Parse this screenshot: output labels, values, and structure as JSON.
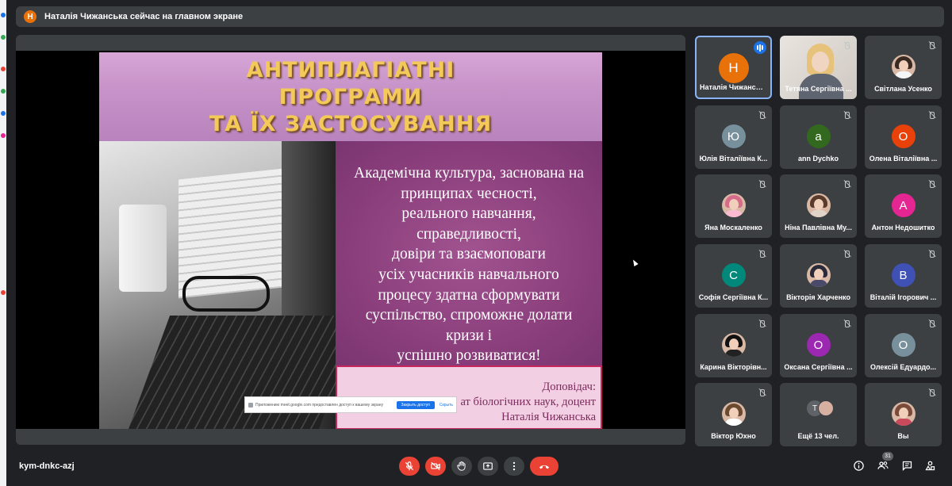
{
  "banner": {
    "avatar_letter": "Н",
    "text": "Наталія Чижанська сейчас на главном экране"
  },
  "slide": {
    "title_lines": [
      "АНТИПЛАГІАТНІ",
      "ПРОГРАМИ",
      "ТА ЇХ ЗАСТОСУВАННЯ"
    ],
    "body_lines": [
      "Академічна культура, заснована на",
      "принципах чесності,",
      "реального навчання,",
      "справедливості,",
      "довіри та взаємоповаги",
      "усіх учасників навчального",
      "процесу здатна сформувати",
      "суспільство, спроможне долати",
      "кризи і",
      "успішно розвиватися!"
    ],
    "speaker_lines": [
      "Доповідач:",
      "ат біологічних наук, доцент",
      "Наталія Чижанська"
    ]
  },
  "share_notice": {
    "message": "Приложению meet.google.com предоставлен доступ к вашему экрану",
    "stop_label": "Закрыть доступ",
    "hide_label": "Скрыть"
  },
  "participants": [
    {
      "name": "Наталія Чижанська",
      "letter": "Н",
      "color": "#e8710a",
      "speaking": true
    },
    {
      "name": "Тетяна Сергіївна ...",
      "video": true
    },
    {
      "name": "Світлана Усенко",
      "photo": true,
      "hair": "#3b2a22",
      "body": "#f5f5f5"
    },
    {
      "name": "Юлія Віталіївна К...",
      "letter": "Ю",
      "color": "#78909c"
    },
    {
      "name": "ann Dychko",
      "letter": "a",
      "color": "#33691e"
    },
    {
      "name": "Олена Віталіївна ...",
      "letter": "О",
      "color": "#e8420a"
    },
    {
      "name": "Яна Москаленко",
      "photo": true,
      "hair": "#d66b8a",
      "body": "#f8bbd0"
    },
    {
      "name": "Ніна Павлівна Му...",
      "photo": true,
      "hair": "#5a3a2a",
      "body": "#e0d4c8"
    },
    {
      "name": "Антон Недошитко",
      "letter": "А",
      "color": "#e52592"
    },
    {
      "name": "Софія Сергіївна К...",
      "letter": "С",
      "color": "#00897b"
    },
    {
      "name": "Вікторія Харченко",
      "photo": true,
      "hair": "#2a2a3a",
      "body": "#4a4a6a"
    },
    {
      "name": "Віталій Ігорович ...",
      "letter": "В",
      "color": "#3f51b5"
    },
    {
      "name": "Карина Вікторівн...",
      "photo": true,
      "hair": "#111111",
      "body": "#222222"
    },
    {
      "name": "Оксана Сергіївна ...",
      "letter": "О",
      "color": "#9c27b0"
    },
    {
      "name": "Олексій Едуардо...",
      "letter": "О",
      "color": "#78909c"
    },
    {
      "name": "Віктор Юхно",
      "photo": true,
      "hair": "#6b4a2f",
      "body": "#ffffff"
    },
    {
      "name": "Ещё 13 чел.",
      "more": true,
      "letter": "Т"
    },
    {
      "name": "Вы",
      "photo": true,
      "hair": "#7a4a3a",
      "body": "#c94a5a"
    }
  ],
  "bottom_bar": {
    "meeting_code": "kym-dnkc-azj",
    "participant_count": "31"
  },
  "icons": {
    "mic": "mic-off-icon",
    "camera": "videocam-off-icon",
    "hand": "raise-hand-icon",
    "present": "present-screen-icon",
    "more": "more-vert-icon",
    "end_call": "call-end-icon",
    "info": "info-icon",
    "people": "people-icon",
    "chat": "chat-icon",
    "activities": "activities-icon"
  }
}
